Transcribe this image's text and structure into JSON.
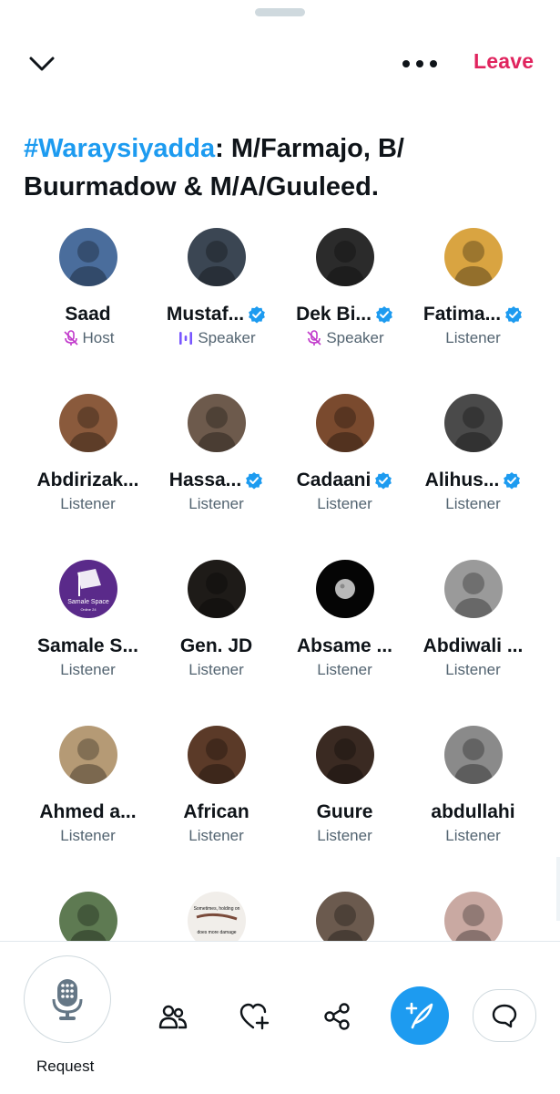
{
  "header": {
    "leave_label": "Leave",
    "title_hashtag": "#Waraysiyadda",
    "title_rest": ": M/Farmajo, B/ Buurmadow & M/A/Guuleed.",
    "icons": {
      "collapse": "chevron-down-icon",
      "more": "more-horizontal-icon"
    }
  },
  "participants": [
    {
      "name": "Saad",
      "role": "Host",
      "role_icon": "mic-muted-icon",
      "verified": false,
      "avatar_bg": "#4a6d9c"
    },
    {
      "name": "Mustaf...",
      "role": "Speaker",
      "role_icon": "speaking-icon",
      "verified": true,
      "avatar_bg": "#3b4653"
    },
    {
      "name": "Dek Bi...",
      "role": "Speaker",
      "role_icon": "mic-muted-icon",
      "verified": true,
      "avatar_bg": "#2b2b2b"
    },
    {
      "name": "Fatima...",
      "role": "Listener",
      "role_icon": "",
      "verified": true,
      "avatar_bg": "#d9a441"
    },
    {
      "name": "Abdirizak...",
      "role": "Listener",
      "role_icon": "",
      "verified": false,
      "avatar_bg": "#8a5a3c"
    },
    {
      "name": "Hassa...",
      "role": "Listener",
      "role_icon": "",
      "verified": true,
      "avatar_bg": "#6d5a4c"
    },
    {
      "name": "Cadaani",
      "role": "Listener",
      "role_icon": "",
      "verified": true,
      "avatar_bg": "#7a4a2e"
    },
    {
      "name": "Alihus...",
      "role": "Listener",
      "role_icon": "",
      "verified": true,
      "avatar_bg": "#4a4a4a"
    },
    {
      "name": "Samale S...",
      "role": "Listener",
      "role_icon": "",
      "verified": false,
      "avatar_bg": "#5a2a8a",
      "avatar_text": [
        "Samale Space",
        "Online 24"
      ]
    },
    {
      "name": "Gen. JD",
      "role": "Listener",
      "role_icon": "",
      "verified": false,
      "avatar_bg": "#1e1b18"
    },
    {
      "name": "Absame ...",
      "role": "Listener",
      "role_icon": "",
      "verified": false,
      "avatar_bg": "#050505"
    },
    {
      "name": "Abdiwali ...",
      "role": "Listener",
      "role_icon": "",
      "verified": false,
      "avatar_bg": "#9a9a9a"
    },
    {
      "name": "Ahmed a...",
      "role": "Listener",
      "role_icon": "",
      "verified": false,
      "avatar_bg": "#b59a75"
    },
    {
      "name": "African",
      "role": "Listener",
      "role_icon": "",
      "verified": false,
      "avatar_bg": "#5b3a28"
    },
    {
      "name": "Guure",
      "role": "Listener",
      "role_icon": "",
      "verified": false,
      "avatar_bg": "#3a2a22"
    },
    {
      "name": "abdullahi",
      "role": "Listener",
      "role_icon": "",
      "verified": false,
      "avatar_bg": "#8a8a8a"
    },
    {
      "name": "",
      "role": "",
      "role_icon": "",
      "verified": false,
      "avatar_bg": "#5e7a52"
    },
    {
      "name": "",
      "role": "",
      "role_icon": "",
      "verified": false,
      "avatar_bg": "#f1eeea",
      "avatar_text": [
        "Sometimes, holding on",
        "does more damage"
      ]
    },
    {
      "name": "",
      "role": "",
      "role_icon": "",
      "verified": false,
      "avatar_bg": "#6b5a4e"
    },
    {
      "name": "",
      "role": "",
      "role_icon": "",
      "verified": false,
      "avatar_bg": "#c9a9a2"
    }
  ],
  "bottom_bar": {
    "request_label": "Request",
    "icons": [
      "microphone-icon",
      "people-icon",
      "heart-add-icon",
      "share-icon",
      "compose-icon",
      "comment-icon"
    ]
  },
  "colors": {
    "accent": "#1d9bf0",
    "leave": "#e0245e",
    "host_purple": "#c13acb",
    "speaker_purple": "#7856ff",
    "muted_text": "#536471"
  }
}
